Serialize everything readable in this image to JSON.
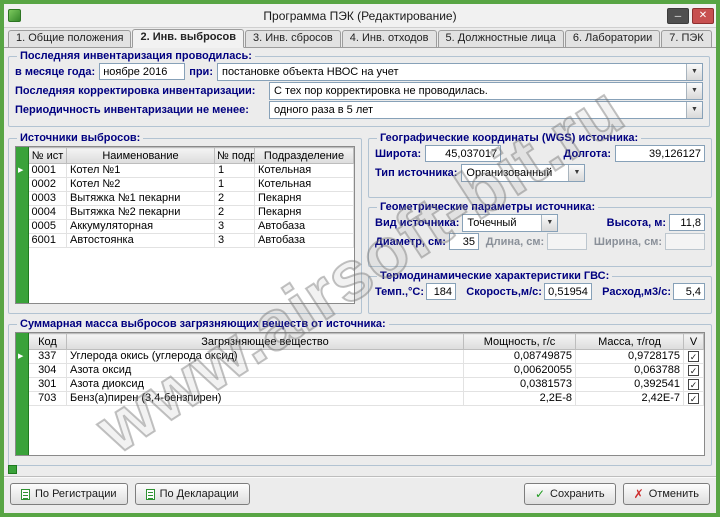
{
  "window": {
    "title": "Программа ПЭК (Редактирование)"
  },
  "icons": {
    "minimize": "─",
    "close": "✕",
    "dropdown": "▼",
    "row_marker": "▶",
    "check": "✓",
    "cross": "✗"
  },
  "colors": {
    "window_border": "#58a544",
    "titlebar_bg": "#f1f1f1",
    "accent_green": "#3aa23a",
    "grid_gutter": "#3aa23a",
    "navy": "#000080",
    "close_red": "#c75050",
    "check_green": "#1f9b1f",
    "cross_red": "#cc2a2a"
  },
  "tabs": [
    {
      "label": "1. Общие положения",
      "active": false
    },
    {
      "label": "2. Инв. выбросов",
      "active": true
    },
    {
      "label": "3. Инв. сбросов",
      "active": false
    },
    {
      "label": "4. Инв. отходов",
      "active": false
    },
    {
      "label": "5. Должностные лица",
      "active": false
    },
    {
      "label": "6. Лаборатории",
      "active": false
    },
    {
      "label": "7. ПЭК",
      "active": false
    }
  ],
  "inventory": {
    "group_title": "Последняя инвентаризация проводилась:",
    "month_label": "в месяце года:",
    "month_value": "ноябре 2016",
    "at_label": "при:",
    "at_value": "постановке объекта НВОС на учет",
    "correction_label": "Последняя корректировка инвентаризации:",
    "correction_value": "С тех пор корректировка не проводилась.",
    "period_label": "Периодичность инвентаризации не менее:",
    "period_value": "одного раза в 5 лет"
  },
  "sources": {
    "group_title": "Источники выбросов:",
    "columns": [
      "№ ист",
      "Наименование",
      "№ подр",
      "Подразделение"
    ],
    "selected_row": 0,
    "rows": [
      [
        "0001",
        "Котел №1",
        "1",
        "Котельная"
      ],
      [
        "0002",
        "Котел №2",
        "1",
        "Котельная"
      ],
      [
        "0003",
        "Вытяжка №1 пекарни",
        "2",
        "Пекарня"
      ],
      [
        "0004",
        "Вытяжка №2 пекарни",
        "2",
        "Пекарня"
      ],
      [
        "0005",
        "Аккумуляторная",
        "3",
        "Автобаза"
      ],
      [
        "6001",
        "Автостоянка",
        "3",
        "Автобаза"
      ]
    ]
  },
  "geo": {
    "group_title": "Географические координаты (WGS) источника:",
    "lat_label": "Широта:",
    "lat_value": "45,037017",
    "lon_label": "Долгота:",
    "lon_value": "39,126127",
    "type_label": "Тип источника:",
    "type_value": "Организованный"
  },
  "geometry": {
    "group_title": "Геометрические параметры источника:",
    "kind_label": "Вид источника:",
    "kind_value": "Точечный",
    "height_label": "Высота, м:",
    "height_value": "11,8",
    "diameter_label": "Диаметр, см:",
    "diameter_value": "35",
    "length_label": "Длина, см:",
    "length_value": "",
    "width_label": "Ширина, см:",
    "width_value": ""
  },
  "thermo": {
    "group_title": "Термодинамические характеристики ГВС:",
    "temp_label": "Темп.,°С:",
    "temp_value": "184",
    "speed_label": "Скорость,м/с:",
    "speed_value": "0,51954",
    "flow_label": "Расход,м3/с:",
    "flow_value": "5,4"
  },
  "emissions": {
    "group_title": "Суммарная масса выбросов загрязняющих веществ от источника:",
    "columns": [
      "Код",
      "Загрязняющее вещество",
      "Мощность, г/с",
      "Масса, т/год",
      "V"
    ],
    "selected_row": 0,
    "rows": [
      {
        "code": "337",
        "substance": "Углерода окись (углерода оксид)",
        "power": "0,08749875",
        "mass": "0,9728175",
        "checked": true
      },
      {
        "code": "304",
        "substance": "Азота оксид",
        "power": "0,00620055",
        "mass": "0,063788",
        "checked": true
      },
      {
        "code": "301",
        "substance": "Азота диоксид",
        "power": "0,0381573",
        "mass": "0,392541",
        "checked": true
      },
      {
        "code": "703",
        "substance": "Бенз(а)пирен (3,4-бензпирен)",
        "power": "2,2E-8",
        "mass": "2,42E-7",
        "checked": true
      }
    ]
  },
  "footer": {
    "registration_label": "По Регистрации",
    "declaration_label": "По Декларации",
    "save_label": "Сохранить",
    "cancel_label": "Отменить"
  },
  "watermark": "www.airsoft-bit.ru"
}
